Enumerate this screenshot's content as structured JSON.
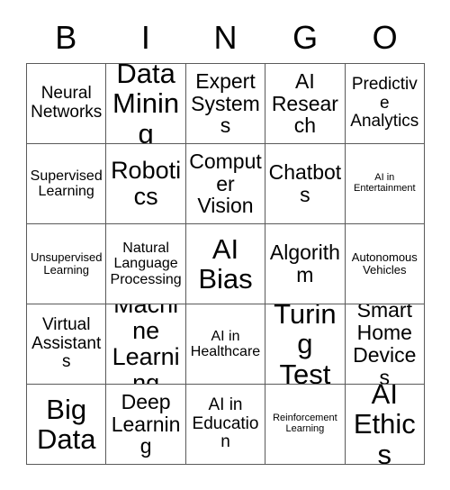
{
  "card": {
    "title_letters": [
      "B",
      "I",
      "N",
      "G",
      "O"
    ],
    "grid_border_color": "#5a5a5a",
    "text_color": "#000000",
    "background_color": "#ffffff",
    "columns": 5,
    "rows": 5,
    "cells": [
      {
        "label": "Neural Networks",
        "size": "fs-m"
      },
      {
        "label": "Data Mining",
        "size": "fs-xxl"
      },
      {
        "label": "Expert Systems",
        "size": "fs-l"
      },
      {
        "label": "AI Research",
        "size": "fs-l"
      },
      {
        "label": "Predictive Analytics",
        "size": "fs-m"
      },
      {
        "label": "Supervised Learning",
        "size": "fs-s"
      },
      {
        "label": "Robotics",
        "size": "fs-xl"
      },
      {
        "label": "Computer Vision",
        "size": "fs-l"
      },
      {
        "label": "Chatbots",
        "size": "fs-l"
      },
      {
        "label": "AI in Entertainment",
        "size": "fs-xxs"
      },
      {
        "label": "Unsupervised Learning",
        "size": "fs-xs"
      },
      {
        "label": "Natural Language Processing",
        "size": "fs-s"
      },
      {
        "label": "AI Bias",
        "size": "fs-xxl"
      },
      {
        "label": "Algorithm",
        "size": "fs-l"
      },
      {
        "label": "Autonomous Vehicles",
        "size": "fs-xs"
      },
      {
        "label": "Virtual Assistants",
        "size": "fs-m"
      },
      {
        "label": "Machine Learning",
        "size": "fs-xl"
      },
      {
        "label": "AI in Healthcare",
        "size": "fs-s"
      },
      {
        "label": "Turing Test",
        "size": "fs-xxl"
      },
      {
        "label": "Smart Home Devices",
        "size": "fs-l"
      },
      {
        "label": "Big Data",
        "size": "fs-xxl"
      },
      {
        "label": "Deep Learning",
        "size": "fs-l"
      },
      {
        "label": "AI in Education",
        "size": "fs-m"
      },
      {
        "label": "Reinforcement Learning",
        "size": "fs-xxs"
      },
      {
        "label": "AI Ethics",
        "size": "fs-xxl"
      }
    ]
  }
}
